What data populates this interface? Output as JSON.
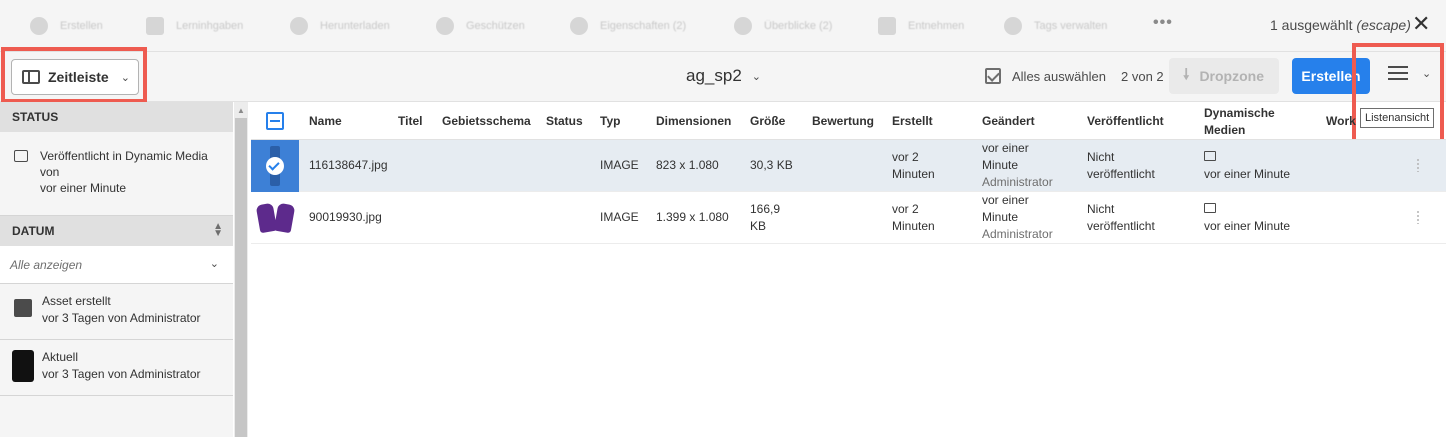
{
  "actionbar": {
    "actions": [
      {
        "label": "Erstellen"
      },
      {
        "label": "Lerninhgaben"
      },
      {
        "label": "Herunterladen"
      },
      {
        "label": "Geschützen"
      },
      {
        "label": "Eigenschaften (2)"
      },
      {
        "label": "Überblicke (2)"
      },
      {
        "label": "Entnehmen"
      },
      {
        "label": "Tags verwalten"
      }
    ],
    "more": "•••",
    "selection": "1 ausgewählt",
    "escape": "(escape)",
    "close": "✕"
  },
  "toolbar": {
    "rail_label": "Zeitleiste",
    "folder": "ag_sp2",
    "select_all": "Alles auswählen",
    "count": "2 von 2",
    "dropzone": "Dropzone",
    "create": "Erstellen",
    "view_tooltip": "Listenansicht"
  },
  "rail": {
    "status_header": "STATUS",
    "status_item": [
      "Veröffentlicht in Dynamic Media",
      "von",
      "vor einer Minute"
    ],
    "date_header": "DATUM",
    "filter_value": "Alle anzeigen",
    "events": [
      {
        "title": "Asset erstellt",
        "sub": "vor 3 Tagen von Administrator"
      },
      {
        "title": "Aktuell",
        "sub": "vor 3 Tagen von Administrator"
      }
    ]
  },
  "table": {
    "columns": {
      "name": "Name",
      "titel": "Titel",
      "schema": "Gebietsschema",
      "status": "Status",
      "typ": "Typ",
      "dimensionen": "Dimensionen",
      "groesse": "Größe",
      "bewertung": "Bewertung",
      "erstellt": "Erstellt",
      "geaendert": "Geändert",
      "veroeffentlicht": "Veröffentlicht",
      "dyn1": "Dynamische",
      "dyn2": "Medien",
      "workflow": "Work"
    },
    "rows": [
      {
        "name": "116138647.jpg",
        "typ": "IMAGE",
        "dim": "823 x 1.080",
        "size1": "30,3 KB",
        "size2": "",
        "created1": "vor 2",
        "created2": "Minuten",
        "mod1": "vor einer",
        "mod2": "Minute",
        "mod3": "Administrator",
        "pub1": "Nicht",
        "pub2": "veröffentlicht",
        "dm": "vor einer Minute",
        "selected": true
      },
      {
        "name": "90019930.jpg",
        "typ": "IMAGE",
        "dim": "1.399 x 1.080",
        "size1": "166,9",
        "size2": "KB",
        "created1": "vor 2",
        "created2": "Minuten",
        "mod1": "vor einer",
        "mod2": "Minute",
        "mod3": "Administrator",
        "pub1": "Nicht",
        "pub2": "veröffentlicht",
        "dm": "vor einer Minute",
        "selected": false
      }
    ]
  },
  "colors": {
    "accent": "#2680eb",
    "highlight": "#ee5b50",
    "selected_row": "#e6ecf2"
  }
}
